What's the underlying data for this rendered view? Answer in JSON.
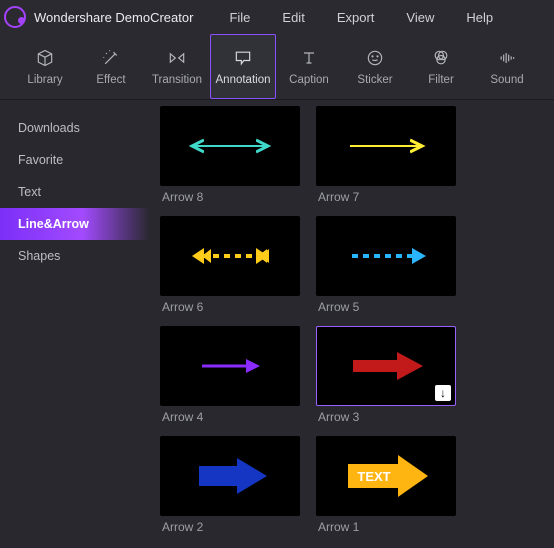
{
  "app": {
    "title": "Wondershare DemoCreator"
  },
  "menu": [
    "File",
    "Edit",
    "Export",
    "View",
    "Help"
  ],
  "tools": [
    {
      "id": "library",
      "label": "Library"
    },
    {
      "id": "effect",
      "label": "Effect"
    },
    {
      "id": "transition",
      "label": "Transition"
    },
    {
      "id": "annotation",
      "label": "Annotation",
      "active": true
    },
    {
      "id": "caption",
      "label": "Caption"
    },
    {
      "id": "sticker",
      "label": "Sticker"
    },
    {
      "id": "filter",
      "label": "Filter"
    },
    {
      "id": "sound",
      "label": "Sound"
    }
  ],
  "sidebar": {
    "items": [
      {
        "label": "Downloads"
      },
      {
        "label": "Favorite"
      },
      {
        "label": "Text"
      },
      {
        "label": "Line&Arrow",
        "active": true
      },
      {
        "label": "Shapes"
      }
    ]
  },
  "gallery": [
    {
      "label": "Arrow 8",
      "kind": "line-double-thin",
      "color": "#3fd9c9"
    },
    {
      "label": "Arrow 7",
      "kind": "line-single-thin",
      "color": "#ffee33"
    },
    {
      "label": "Arrow 6",
      "kind": "dashed-double",
      "color": "#ffcc1a"
    },
    {
      "label": "Arrow 5",
      "kind": "dashed-single",
      "color": "#29b6ff"
    },
    {
      "label": "Arrow 4",
      "kind": "line-single-thin",
      "color": "#8a2bff"
    },
    {
      "label": "Arrow 3",
      "kind": "block-arrow",
      "color": "#c21a1a",
      "selected": true,
      "downloadable": true
    },
    {
      "label": "Arrow 2",
      "kind": "block-arrow",
      "color": "#1436c2"
    },
    {
      "label": "Arrow 1",
      "kind": "block-arrow-text",
      "color": "#ffb511",
      "text": "TEXT"
    }
  ]
}
